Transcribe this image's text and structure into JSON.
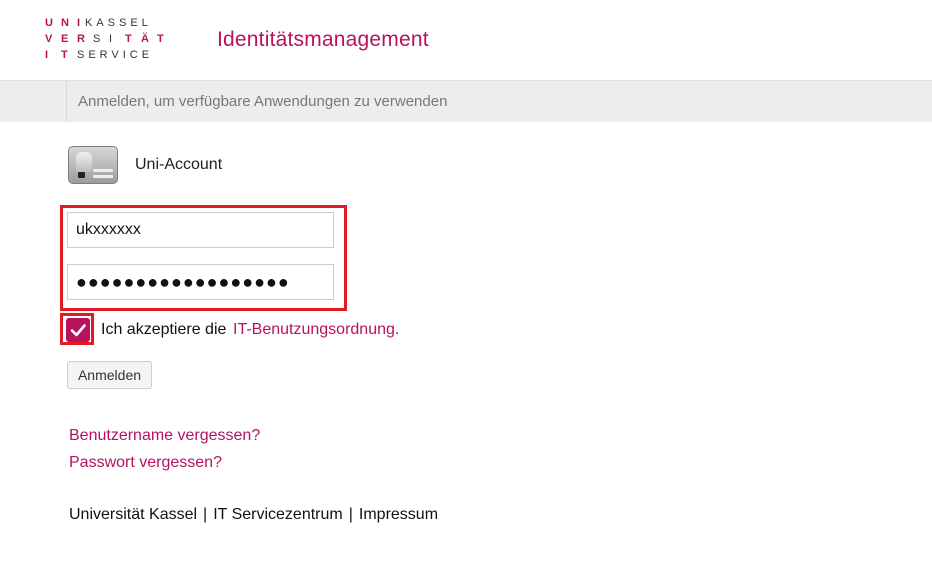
{
  "logo": {
    "row1": [
      "U",
      "N",
      "I",
      "KASSEL"
    ],
    "row2": [
      "V",
      "E",
      "R",
      "S",
      "I",
      "T",
      "Ä",
      "T"
    ],
    "row3": [
      "I",
      "T",
      "SERVICE"
    ]
  },
  "header": {
    "title": "Identitätsmanagement"
  },
  "banner": {
    "text": "Anmelden, um verfügbare Anwendungen zu verwenden"
  },
  "account": {
    "title": "Uni-Account"
  },
  "form": {
    "username_value": "ukxxxxxx",
    "password_value": "●●●●●●●●●●●●●●●●●●",
    "accept_label": "Ich akzeptiere die",
    "accept_link": "IT-Benutzungsordnung.",
    "accept_checked": true,
    "login_button": "Anmelden"
  },
  "links": {
    "forgot_username": "Benutzername vergessen?",
    "forgot_password": "Passwort vergessen?"
  },
  "footer": {
    "items": [
      "Universität Kassel",
      "IT Servicezentrum",
      "Impressum"
    ],
    "separator": "|"
  },
  "colors": {
    "accent": "#b8125f",
    "highlight": "#e11b22",
    "banner_bg": "#eceeee"
  }
}
